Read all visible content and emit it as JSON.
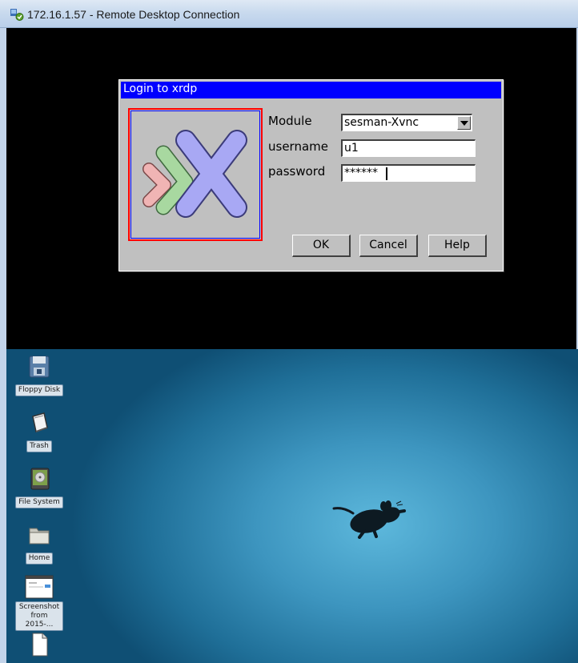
{
  "rdp_window": {
    "title": "172.16.1.57 - Remote Desktop Connection",
    "icon": "remote-desktop-icon"
  },
  "login_dialog": {
    "title": "Login to xrdp",
    "logo": "xrdp-logo-icon",
    "module_label": "Module",
    "module_value": "sesman-Xvnc",
    "username_label": "username",
    "username_value": "u1",
    "password_label": "password",
    "password_value": "******",
    "buttons": {
      "ok": "OK",
      "cancel": "Cancel",
      "help": "Help"
    },
    "colors": {
      "titlebar": "#0000ff",
      "background": "#c0c0c0"
    }
  },
  "desktop": {
    "icons": [
      {
        "label": "Floppy Disk",
        "icon": "floppy-disk-icon"
      },
      {
        "label": "Trash",
        "icon": "trash-icon"
      },
      {
        "label": "File System",
        "icon": "hard-drive-icon"
      },
      {
        "label": "Home",
        "icon": "folder-icon"
      },
      {
        "label": "Screenshot from 2015-...",
        "icon": "image-file-icon"
      },
      {
        "label": "",
        "icon": "document-icon"
      }
    ],
    "wallpaper_logo": "xfce-mouse-icon"
  }
}
